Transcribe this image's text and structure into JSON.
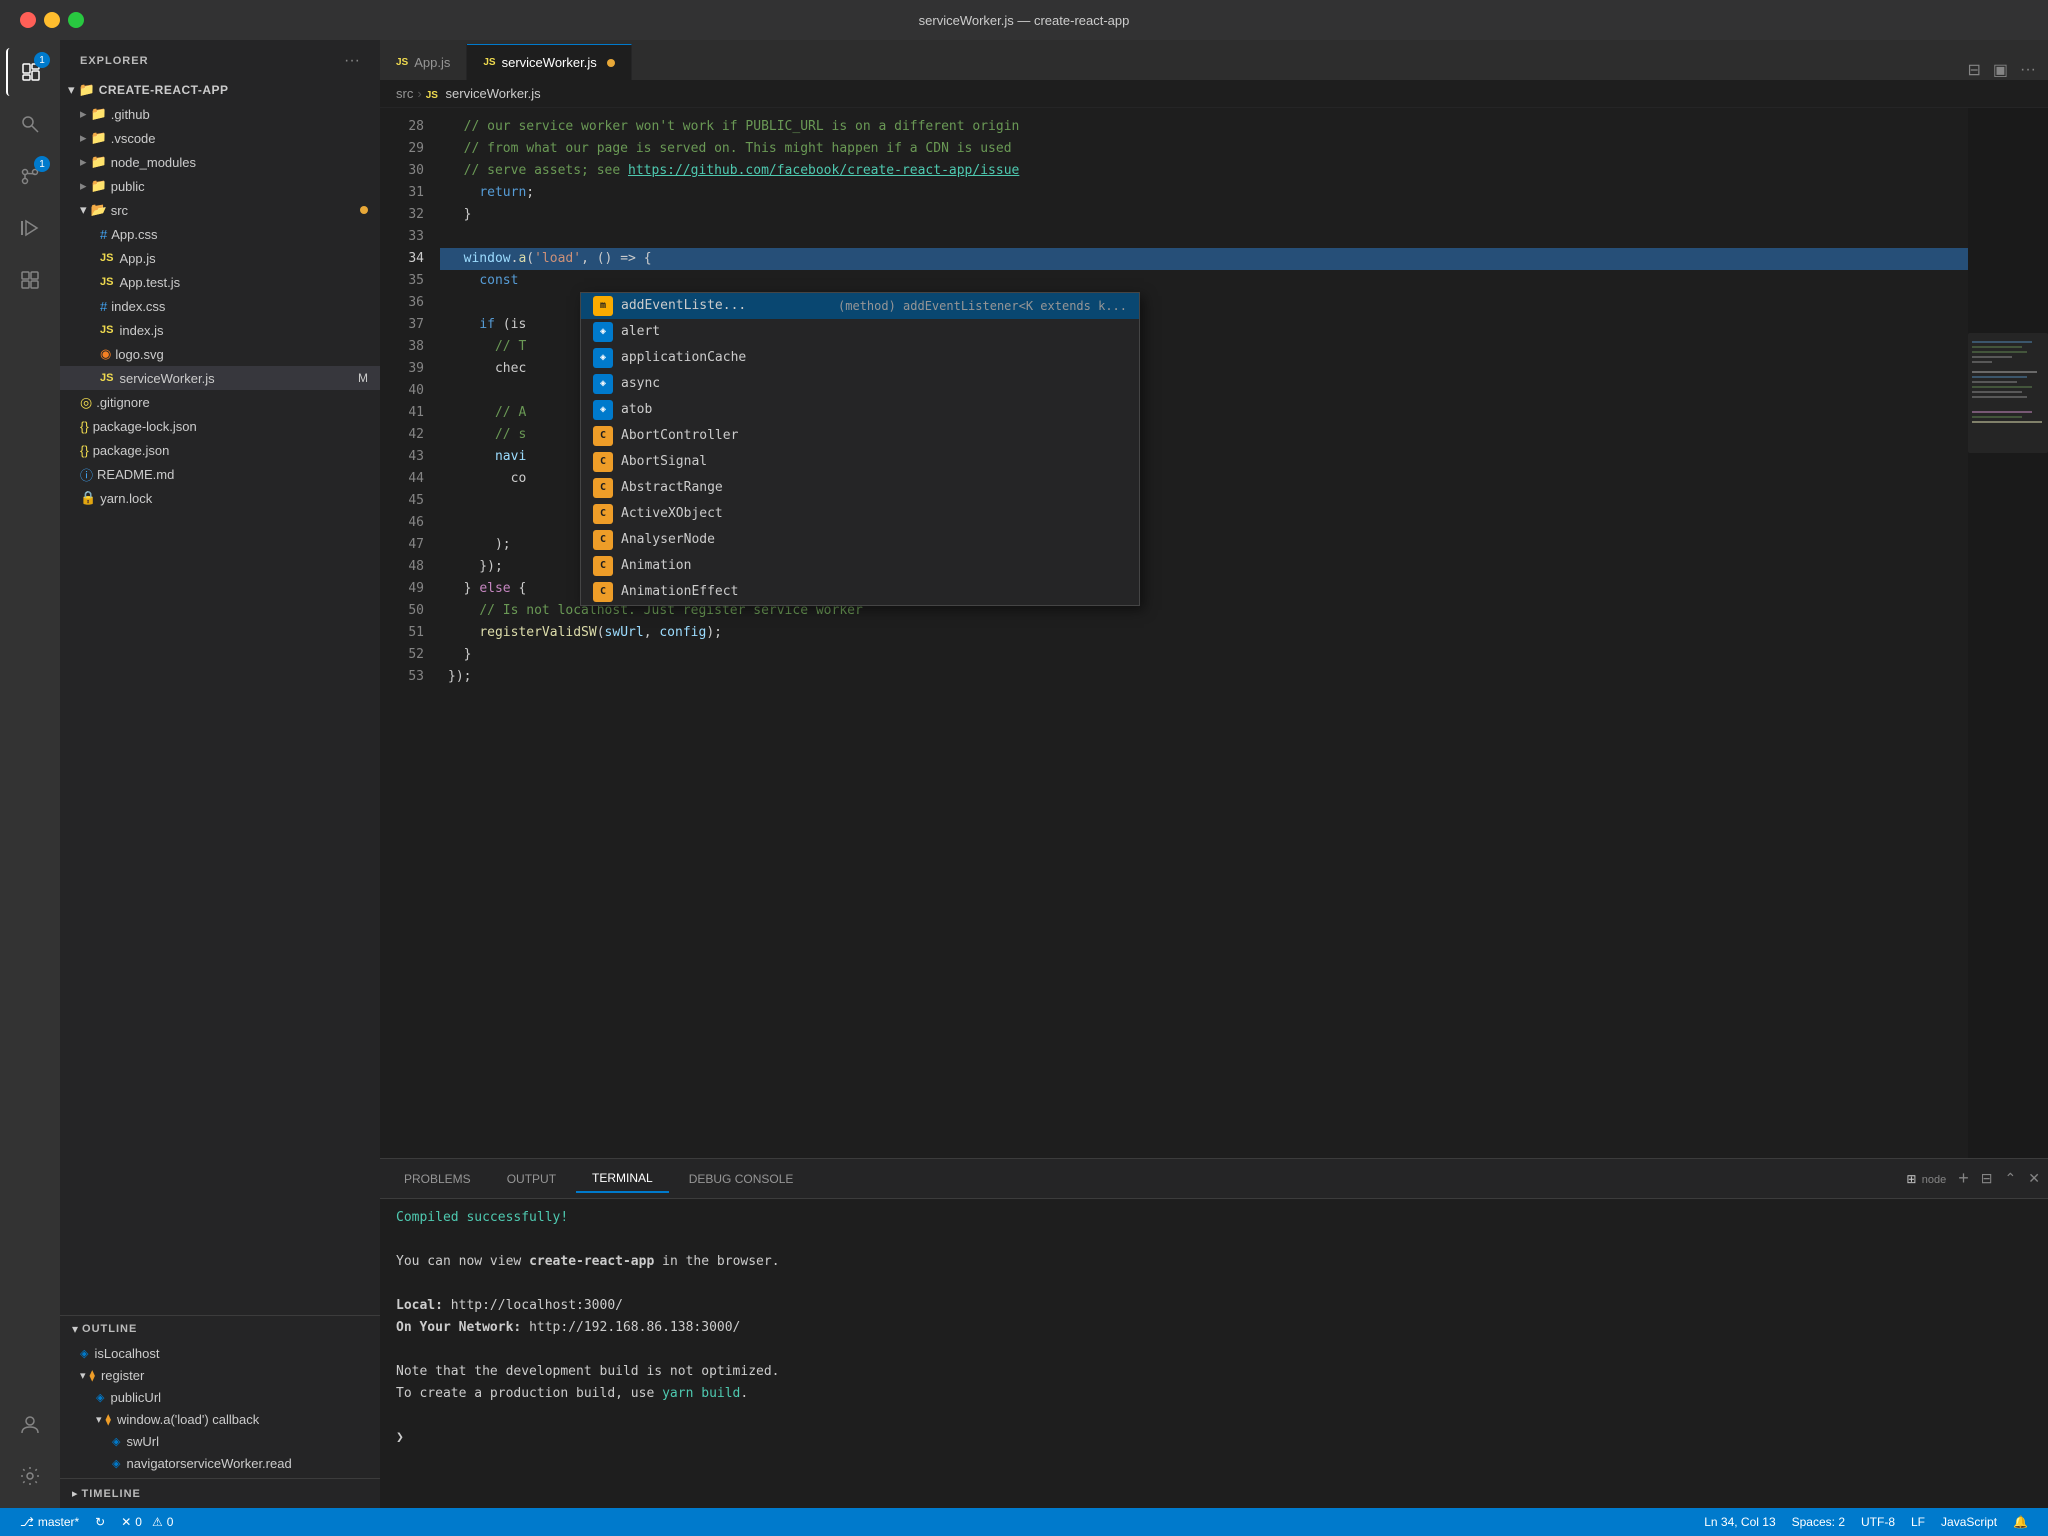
{
  "titlebar": {
    "title": "serviceWorker.js — create-react-app"
  },
  "activity_bar": {
    "icons": [
      {
        "name": "explorer-icon",
        "symbol": "⊞",
        "badge": "1",
        "active": true
      },
      {
        "name": "search-icon",
        "symbol": "🔍",
        "badge": null,
        "active": false
      },
      {
        "name": "source-control-icon",
        "symbol": "⎇",
        "badge": "1",
        "active": false
      },
      {
        "name": "run-icon",
        "symbol": "▶",
        "badge": null,
        "active": false
      },
      {
        "name": "extensions-icon",
        "symbol": "⊟",
        "badge": null,
        "active": false
      }
    ],
    "bottom_icons": [
      {
        "name": "account-icon",
        "symbol": "👤"
      },
      {
        "name": "settings-icon",
        "symbol": "⚙"
      }
    ]
  },
  "sidebar": {
    "header": "EXPLORER",
    "root_folder": "CREATE-REACT-APP",
    "files": [
      {
        "type": "folder",
        "name": ".github",
        "indent": 1,
        "collapsed": true
      },
      {
        "type": "folder",
        "name": ".vscode",
        "indent": 1,
        "collapsed": true
      },
      {
        "type": "folder",
        "name": "node_modules",
        "indent": 1,
        "collapsed": true
      },
      {
        "type": "folder",
        "name": "public",
        "indent": 1,
        "collapsed": true
      },
      {
        "type": "folder",
        "name": "src",
        "indent": 1,
        "collapsed": false,
        "modified": true
      },
      {
        "type": "file-css",
        "name": "App.css",
        "indent": 2
      },
      {
        "type": "file-js",
        "name": "App.js",
        "indent": 2
      },
      {
        "type": "file-js",
        "name": "App.test.js",
        "indent": 2
      },
      {
        "type": "file-css",
        "name": "index.css",
        "indent": 2
      },
      {
        "type": "file-js",
        "name": "index.js",
        "indent": 2
      },
      {
        "type": "file-svg",
        "name": "logo.svg",
        "indent": 2
      },
      {
        "type": "file-js",
        "name": "serviceWorker.js",
        "indent": 2,
        "active": true,
        "modified": true
      },
      {
        "type": "file-git",
        "name": ".gitignore",
        "indent": 1
      },
      {
        "type": "file-json",
        "name": "package-lock.json",
        "indent": 1
      },
      {
        "type": "file-json",
        "name": "package.json",
        "indent": 1
      },
      {
        "type": "file-info",
        "name": "README.md",
        "indent": 1
      },
      {
        "type": "file-yarn",
        "name": "yarn.lock",
        "indent": 1
      }
    ]
  },
  "outline": {
    "header": "OUTLINE",
    "items": [
      {
        "name": "isLocalhost",
        "icon": "◈",
        "indent": 1
      },
      {
        "name": "register",
        "icon": "⧫",
        "indent": 1,
        "collapsed": false
      },
      {
        "name": "publicUrl",
        "icon": "◈",
        "indent": 2
      },
      {
        "name": "window.a('load') callback",
        "icon": "⧫",
        "indent": 2,
        "collapsed": false
      },
      {
        "name": "swUrl",
        "icon": "◈",
        "indent": 3
      },
      {
        "name": "navigatorserviceWorker.read",
        "icon": "◈",
        "indent": 3
      }
    ]
  },
  "timeline": {
    "header": "TIMELINE"
  },
  "tabs": [
    {
      "name": "App.js",
      "lang": "JS",
      "active": false
    },
    {
      "name": "serviceWorker.js",
      "lang": "JS",
      "active": true,
      "modified": true
    }
  ],
  "breadcrumb": {
    "parts": [
      "src",
      "JS serviceWorker.js"
    ]
  },
  "editor": {
    "lines": [
      {
        "num": 28,
        "content": "  // our service worker won't work if PUBLIC_URL is on a different origin"
      },
      {
        "num": 29,
        "content": "  // from what our page is served on. This might happen if a CDN is used"
      },
      {
        "num": 30,
        "content": "  // serve assets; see https://github.com/facebook/create-react-app/issue"
      },
      {
        "num": 31,
        "content": "    return;"
      },
      {
        "num": 32,
        "content": "  }"
      },
      {
        "num": 33,
        "content": ""
      },
      {
        "num": 34,
        "content": "  window.a('load', () => {",
        "highlighted": true
      },
      {
        "num": 35,
        "content": "    const "
      },
      {
        "num": 36,
        "content": ""
      },
      {
        "num": 37,
        "content": "    if (is"
      },
      {
        "num": 38,
        "content": "      // T                                                              stil"
      },
      {
        "num": 39,
        "content": "      chec"
      },
      {
        "num": 40,
        "content": ""
      },
      {
        "num": 41,
        "content": "      // A                                                              to t"
      },
      {
        "num": 42,
        "content": "      // s"
      },
      {
        "num": 43,
        "content": "      navi"
      },
      {
        "num": 44,
        "content": "        co"
      },
      {
        "num": 45,
        "content": ""
      },
      {
        "num": 46,
        "content": ""
      },
      {
        "num": 47,
        "content": "      );"
      },
      {
        "num": 48,
        "content": "    });"
      },
      {
        "num": 49,
        "content": "  } else {"
      },
      {
        "num": 50,
        "content": "    // Is not localhost. Just register service worker"
      },
      {
        "num": 51,
        "content": "    registerValidSW(swUrl, config);"
      },
      {
        "num": 52,
        "content": "  }"
      },
      {
        "num": 53,
        "content": "});"
      }
    ],
    "cursor_line": 34,
    "cursor_col": 13
  },
  "autocomplete": {
    "items": [
      {
        "label": "addEventListe...",
        "type_info": "(method) addEventListener<K extends k...",
        "kind": "method",
        "selected": true
      },
      {
        "label": "alert",
        "type_info": "",
        "kind": "prop"
      },
      {
        "label": "applicationCache",
        "type_info": "",
        "kind": "prop"
      },
      {
        "label": "async",
        "type_info": "",
        "kind": "prop"
      },
      {
        "label": "atob",
        "type_info": "",
        "kind": "prop"
      },
      {
        "label": "AbortController",
        "type_info": "",
        "kind": "class"
      },
      {
        "label": "AbortSignal",
        "type_info": "",
        "kind": "class"
      },
      {
        "label": "AbstractRange",
        "type_info": "",
        "kind": "class"
      },
      {
        "label": "ActiveXObject",
        "type_info": "",
        "kind": "class"
      },
      {
        "label": "AnalyserNode",
        "type_info": "",
        "kind": "class"
      },
      {
        "label": "Animation",
        "type_info": "",
        "kind": "class"
      },
      {
        "label": "AnimationEffect",
        "type_info": "",
        "kind": "class"
      }
    ]
  },
  "terminal": {
    "tabs": [
      "PROBLEMS",
      "OUTPUT",
      "TERMINAL",
      "DEBUG CONSOLE"
    ],
    "active_tab": "TERMINAL",
    "content": [
      {
        "text": "Compiled successfully!",
        "class": "term-success"
      },
      {
        "text": ""
      },
      {
        "text": "You can now view create-react-app in the browser.",
        "bold_part": "create-react-app"
      },
      {
        "text": ""
      },
      {
        "text": "  Local:            http://localhost:3000/",
        "label": "Local:"
      },
      {
        "text": "  On Your Network:  http://192.168.86.138:3000/",
        "label": "On Your Network:"
      },
      {
        "text": ""
      },
      {
        "text": "Note that the development build is not optimized."
      },
      {
        "text": "To create a production build, use yarn build.",
        "link": "yarn build"
      },
      {
        "text": "❯"
      }
    ],
    "new_terminal_label": "node",
    "shell_indicator": "❯"
  },
  "status_bar": {
    "branch": "master*",
    "sync_icon": "↻",
    "errors": "0",
    "warnings": "0",
    "cursor_pos": "Ln 34, Col 13",
    "spaces": "Spaces: 2",
    "encoding": "UTF-8",
    "line_ending": "LF",
    "language": "JavaScript",
    "notification_icon": "🔔"
  }
}
